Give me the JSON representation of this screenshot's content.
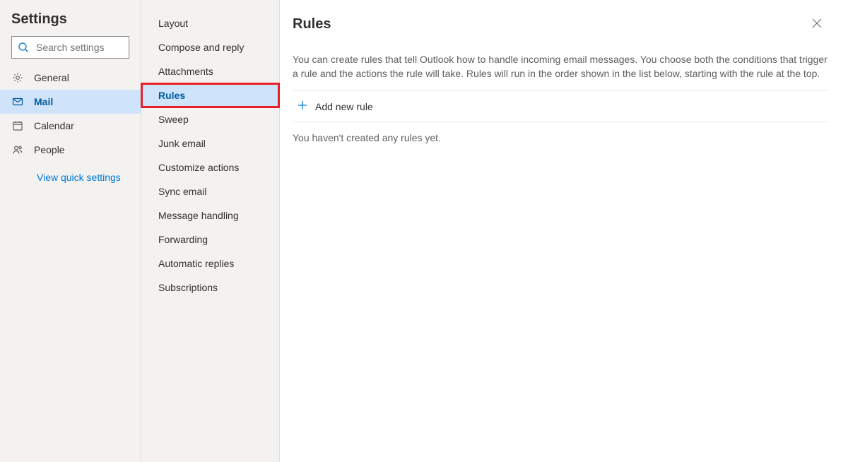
{
  "col1": {
    "title": "Settings",
    "search_placeholder": "Search settings",
    "items": [
      {
        "label": "General"
      },
      {
        "label": "Mail"
      },
      {
        "label": "Calendar"
      },
      {
        "label": "People"
      }
    ],
    "quick_link": "View quick settings"
  },
  "col2": {
    "items": [
      {
        "label": "Layout"
      },
      {
        "label": "Compose and reply"
      },
      {
        "label": "Attachments"
      },
      {
        "label": "Rules"
      },
      {
        "label": "Sweep"
      },
      {
        "label": "Junk email"
      },
      {
        "label": "Customize actions"
      },
      {
        "label": "Sync email"
      },
      {
        "label": "Message handling"
      },
      {
        "label": "Forwarding"
      },
      {
        "label": "Automatic replies"
      },
      {
        "label": "Subscriptions"
      }
    ]
  },
  "main": {
    "title": "Rules",
    "description": "You can create rules that tell Outlook how to handle incoming email messages. You choose both the conditions that trigger a rule and the actions the rule will take. Rules will run in the order shown in the list below, starting with the rule at the top.",
    "add_label": "Add new rule",
    "empty_text": "You haven't created any rules yet."
  }
}
